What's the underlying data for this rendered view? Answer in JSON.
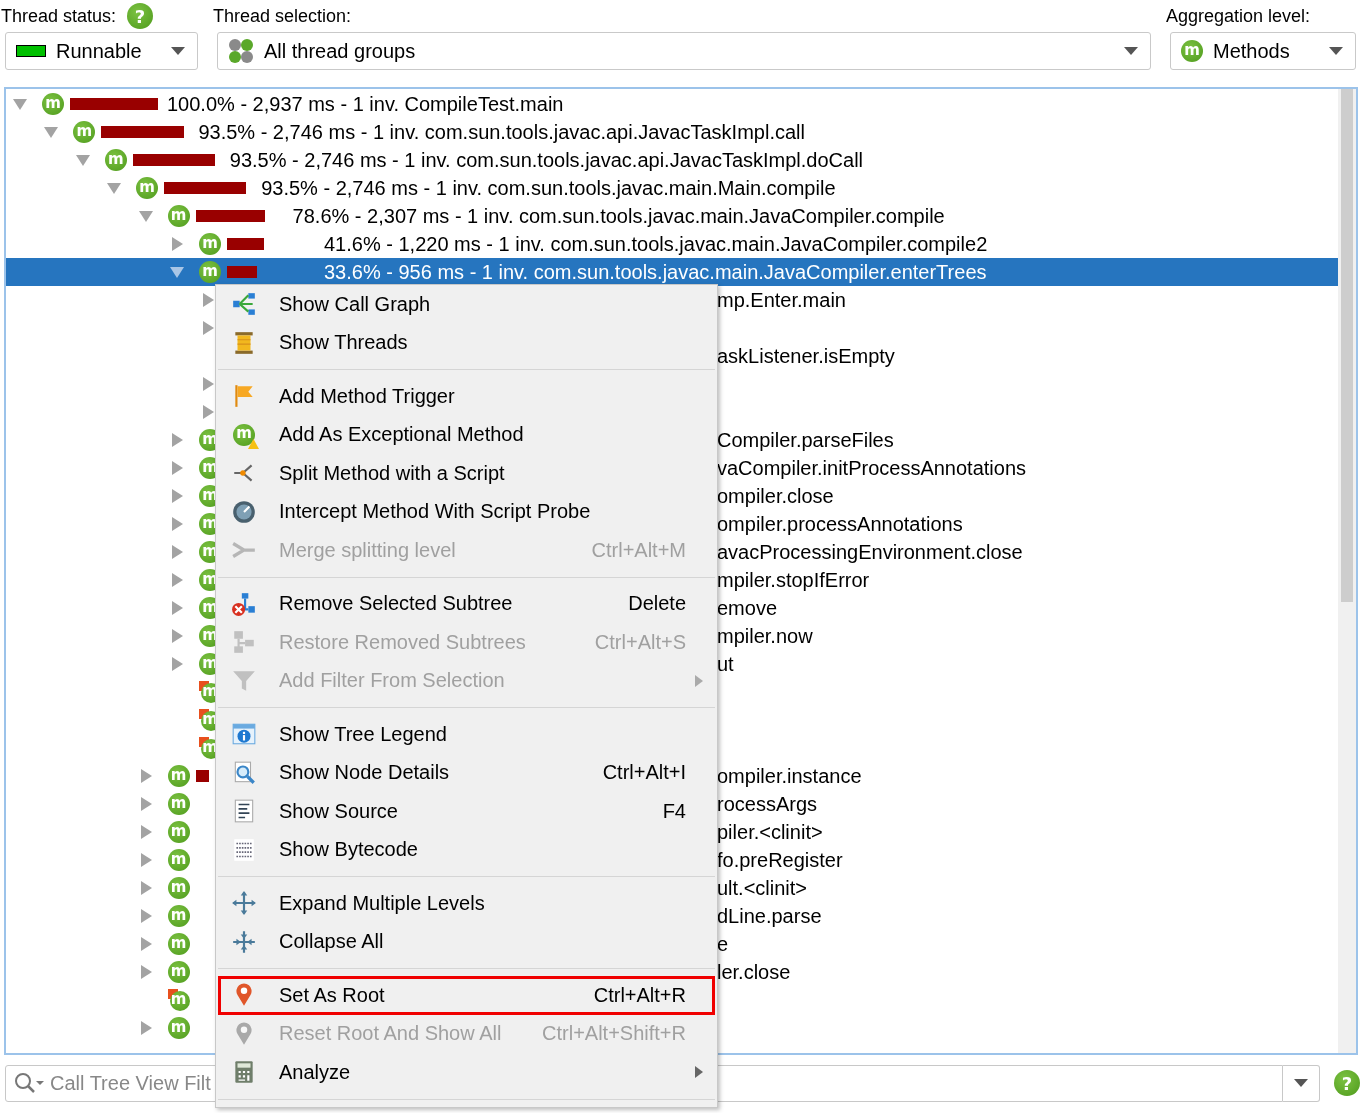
{
  "toolbar": {
    "thread_status": {
      "label": "Thread status:",
      "help": "?",
      "value": "Runnable"
    },
    "thread_selection": {
      "label": "Thread selection:",
      "value": "All thread groups"
    },
    "aggregation_level": {
      "label": "Aggregation level:",
      "value": "Methods",
      "badge": "m"
    }
  },
  "call_tree": {
    "nodes": [
      {
        "badge": "m",
        "level": 1.0,
        "label": "100.0% - 2,937 ms - 1 inv. CompileTest.main",
        "expanded": true,
        "selected": false,
        "flagged": false,
        "children": [
          {
            "badge": "m",
            "level": 0.935,
            "label": "93.5% - 2,746 ms - 1 inv. com.sun.tools.javac.api.JavacTaskImpl.call",
            "expanded": true,
            "selected": false,
            "flagged": false,
            "children": [
              {
                "badge": "m",
                "level": 0.935,
                "label": "93.5% - 2,746 ms - 1 inv. com.sun.tools.javac.api.JavacTaskImpl.doCall",
                "expanded": true,
                "selected": false,
                "flagged": false,
                "children": [
                  {
                    "badge": "m",
                    "level": 0.935,
                    "label": "93.5% - 2,746 ms - 1 inv. com.sun.tools.javac.main.Main.compile",
                    "expanded": true,
                    "selected": false,
                    "flagged": false,
                    "children": [
                      {
                        "badge": "m",
                        "level": 0.786,
                        "label": "78.6% - 2,307 ms - 1 inv. com.sun.tools.javac.main.JavaCompiler.compile",
                        "expanded": true,
                        "selected": false,
                        "flagged": false,
                        "children": [
                          {
                            "badge": "m",
                            "level": 0.416,
                            "label": "41.6% - 1,220 ms - 1 inv. com.sun.tools.javac.main.JavaCompiler.compile2",
                            "expanded": false,
                            "selected": false,
                            "flagged": false
                          },
                          {
                            "badge": "m",
                            "level": 0.336,
                            "label": "33.6% - 956 ms - 1 inv. com.sun.tools.javac.main.JavaCompiler.enterTrees",
                            "expanded": true,
                            "selected": true,
                            "flagged": false,
                            "children": [
                              {
                                "label": "mp.Enter.main",
                                "expanded": false,
                                "selected": false
                              },
                              {
                                "expanded": false,
                                "selected": false
                              },
                              {
                                "label": "askListener.isEmpty",
                                "selected": false
                              },
                              {
                                "expanded": false,
                                "selected": false
                              },
                              {
                                "expanded": false,
                                "selected": false
                              }
                            ]
                          },
                          {
                            "badge": "m",
                            "label": "Compiler.parseFiles",
                            "expanded": false,
                            "selected": false,
                            "flagged": false
                          },
                          {
                            "badge": "m",
                            "label": "vaCompiler.initProcessAnnotations",
                            "expanded": false,
                            "selected": false,
                            "flagged": false
                          },
                          {
                            "badge": "m",
                            "label": "ompiler.close",
                            "expanded": false,
                            "selected": false,
                            "flagged": false
                          },
                          {
                            "badge": "m",
                            "label": "ompiler.processAnnotations",
                            "expanded": false,
                            "selected": false,
                            "flagged": false
                          },
                          {
                            "badge": "m",
                            "label": "avacProcessingEnvironment.close",
                            "expanded": false,
                            "selected": false,
                            "flagged": false
                          },
                          {
                            "badge": "m",
                            "label": "mpiler.stopIfError",
                            "expanded": false,
                            "selected": false,
                            "flagged": false
                          },
                          {
                            "badge": "m",
                            "label": "emove",
                            "expanded": false,
                            "selected": false,
                            "flagged": false
                          },
                          {
                            "badge": "m",
                            "label": "mpiler.now",
                            "expanded": false,
                            "selected": false,
                            "flagged": false
                          },
                          {
                            "badge": "m",
                            "label": "ut",
                            "expanded": false,
                            "selected": false,
                            "flagged": false
                          },
                          {
                            "badge": "m",
                            "selected": false,
                            "flagged": true
                          },
                          {
                            "badge": "m",
                            "selected": false,
                            "flagged": true
                          },
                          {
                            "badge": "m",
                            "selected": false,
                            "flagged": true
                          }
                        ]
                      },
                      {
                        "badge": "m",
                        "level": 0.15,
                        "label": "ompiler.instance",
                        "expanded": false,
                        "selected": false,
                        "flagged": false
                      },
                      {
                        "badge": "m",
                        "label": "rocessArgs",
                        "expanded": false,
                        "selected": false,
                        "flagged": false
                      },
                      {
                        "badge": "m",
                        "label": "piler.<clinit>",
                        "expanded": false,
                        "selected": false,
                        "flagged": false
                      },
                      {
                        "badge": "m",
                        "label": "fo.preRegister",
                        "expanded": false,
                        "selected": false,
                        "flagged": false
                      },
                      {
                        "badge": "m",
                        "label": "ult.<clinit>",
                        "expanded": false,
                        "selected": false,
                        "flagged": false
                      },
                      {
                        "badge": "m",
                        "label": "dLine.parse",
                        "expanded": false,
                        "selected": false,
                        "flagged": false
                      },
                      {
                        "badge": "m",
                        "label": "e",
                        "expanded": false,
                        "selected": false,
                        "flagged": false
                      },
                      {
                        "badge": "m",
                        "label": "ler.close",
                        "expanded": false,
                        "selected": false,
                        "flagged": false
                      },
                      {
                        "badge": "m",
                        "selected": false,
                        "flagged": true
                      },
                      {
                        "badge": "m",
                        "expanded": false,
                        "selected": false,
                        "flagged": false
                      }
                    ]
                  }
                ]
              }
            ]
          }
        ]
      }
    ]
  },
  "context_menu": {
    "groups": [
      [
        {
          "label": "Show Call Graph",
          "disabled": false,
          "submenu": false,
          "highlighted": false
        },
        {
          "label": "Show Threads",
          "disabled": false,
          "submenu": false,
          "highlighted": false
        }
      ],
      [
        {
          "label": "Add Method Trigger",
          "disabled": false,
          "submenu": false,
          "highlighted": false
        },
        {
          "icon_text": "m",
          "label": "Add As Exceptional Method",
          "disabled": false,
          "submenu": false,
          "highlighted": false
        },
        {
          "label": "Split Method with a Script",
          "disabled": false,
          "submenu": false,
          "highlighted": false
        },
        {
          "label": "Intercept Method With Script Probe",
          "disabled": false,
          "submenu": false,
          "highlighted": false
        },
        {
          "label": "Merge splitting level",
          "shortcut": "Ctrl+Alt+M",
          "disabled": true,
          "submenu": false,
          "highlighted": false
        }
      ],
      [
        {
          "label": "Remove Selected Subtree",
          "shortcut": "Delete",
          "disabled": false,
          "submenu": false,
          "highlighted": false
        },
        {
          "label": "Restore Removed Subtrees",
          "shortcut": "Ctrl+Alt+S",
          "disabled": true,
          "submenu": false,
          "highlighted": false
        },
        {
          "label": "Add Filter From Selection",
          "disabled": true,
          "submenu": true,
          "highlighted": false
        }
      ],
      [
        {
          "label": "Show Tree Legend",
          "disabled": false,
          "submenu": false,
          "highlighted": false
        },
        {
          "label": "Show Node Details",
          "shortcut": "Ctrl+Alt+I",
          "disabled": false,
          "submenu": false,
          "highlighted": false
        },
        {
          "label": "Show Source",
          "shortcut": "F4",
          "disabled": false,
          "submenu": false,
          "highlighted": false
        },
        {
          "label": "Show Bytecode",
          "disabled": false,
          "submenu": false,
          "highlighted": false
        }
      ],
      [
        {
          "label": "Expand Multiple Levels",
          "disabled": false,
          "submenu": false,
          "highlighted": false
        },
        {
          "label": "Collapse All",
          "disabled": false,
          "submenu": false,
          "highlighted": false
        }
      ],
      [
        {
          "label": "Set As Root",
          "shortcut": "Ctrl+Alt+R",
          "disabled": false,
          "submenu": false,
          "highlighted": true
        },
        {
          "label": "Reset Root And Show All",
          "shortcut": "Ctrl+Alt+Shift+R",
          "disabled": true,
          "submenu": false,
          "highlighted": false
        },
        {
          "label": "Analyze",
          "disabled": false,
          "submenu": true,
          "highlighted": false
        }
      ]
    ]
  },
  "filter_bar": {
    "placeholder": "Call Tree View Filt",
    "help": "?"
  }
}
